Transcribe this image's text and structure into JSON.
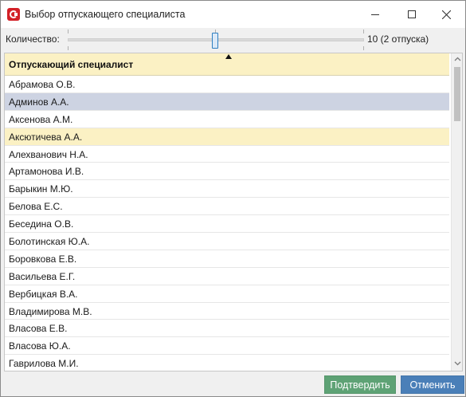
{
  "window": {
    "title": "Выбор отпускающего специалиста"
  },
  "icons": {
    "app": "app-logo-icon",
    "minimize": "minimize-icon",
    "maximize": "maximize-icon",
    "close": "close-icon",
    "sort": "sort-indicator-icon",
    "scroll_up": "scroll-up-arrow-icon",
    "scroll_down": "scroll-down-arrow-icon"
  },
  "quantity": {
    "label": "Количество:",
    "value_text": "10 (2 отпуска)",
    "slider_position": 0.5
  },
  "table": {
    "column_header": "Отпускающий специалист",
    "rows": [
      "Абрамова О.В.",
      "Админов А.А.",
      "Аксенова А.М.",
      "Аксютичева А.А.",
      "Алехванович Н.А.",
      "Артамонова И.В.",
      "Барыкин М.Ю.",
      "Белова Е.С.",
      "Беседина О.В.",
      "Болотинская Ю.А.",
      "Боровкова Е.В.",
      "Васильева Е.Г.",
      "Вербицкая В.А.",
      "Владимирова М.В.",
      "Власова Е.В.",
      "Власова Ю.А.",
      "Гаврилова М.И."
    ],
    "selected_row": 1,
    "focused_row": 3
  },
  "buttons": {
    "confirm": "Подтвердить",
    "cancel": "Отменить"
  },
  "colors": {
    "header_bg": "#fbf1c4",
    "selected_row": "#cdd3e2",
    "confirm_button": "#5ea275",
    "cancel_button": "#4a7fb8",
    "app_icon": "#d32027"
  }
}
